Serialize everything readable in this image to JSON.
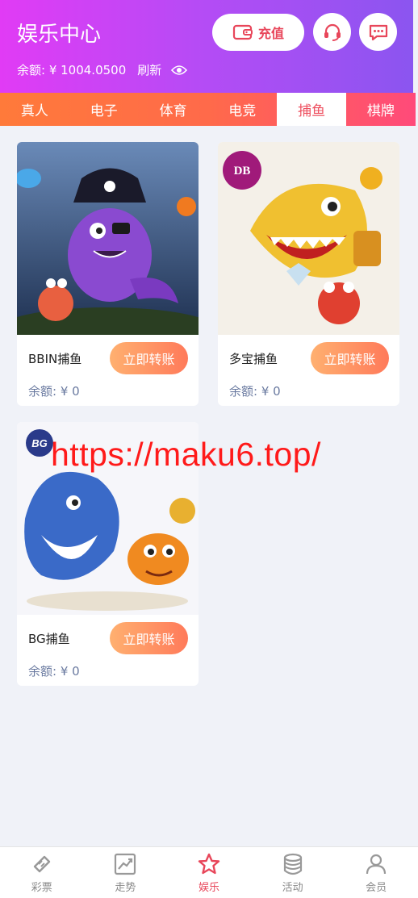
{
  "header": {
    "title": "娱乐中心",
    "balance_text": "余额: ¥ 1004.0500",
    "refresh_label": "刷新",
    "recharge_label": "充值"
  },
  "tabs": [
    {
      "label": "真人",
      "active": false
    },
    {
      "label": "电子",
      "active": false
    },
    {
      "label": "体育",
      "active": false
    },
    {
      "label": "电竞",
      "active": false
    },
    {
      "label": "捕鱼",
      "active": true
    },
    {
      "label": "棋牌",
      "active": false
    }
  ],
  "games": [
    {
      "name": "BBIN捕鱼",
      "button_label": "立即转账",
      "amount": "余额: ¥ 0"
    },
    {
      "name": "多宝捕鱼",
      "button_label": "立即转账",
      "amount": "余额: ¥ 0",
      "logo_text": "DB"
    },
    {
      "name": "BG捕鱼",
      "button_label": "立即转账",
      "amount": "余额: ¥ 0",
      "logo_text": "BG"
    }
  ],
  "watermark": "https://maku6.top/",
  "bottom_nav": [
    {
      "label": "彩票",
      "icon": "lottery-icon"
    },
    {
      "label": "走势",
      "icon": "trend-icon"
    },
    {
      "label": "娱乐",
      "icon": "star-icon",
      "active": true
    },
    {
      "label": "活动",
      "icon": "coins-icon"
    },
    {
      "label": "会员",
      "icon": "user-icon"
    }
  ],
  "colors": {
    "accent": "#e8465a",
    "header_start": "#e13bf5",
    "header_end": "#8b55f0"
  }
}
